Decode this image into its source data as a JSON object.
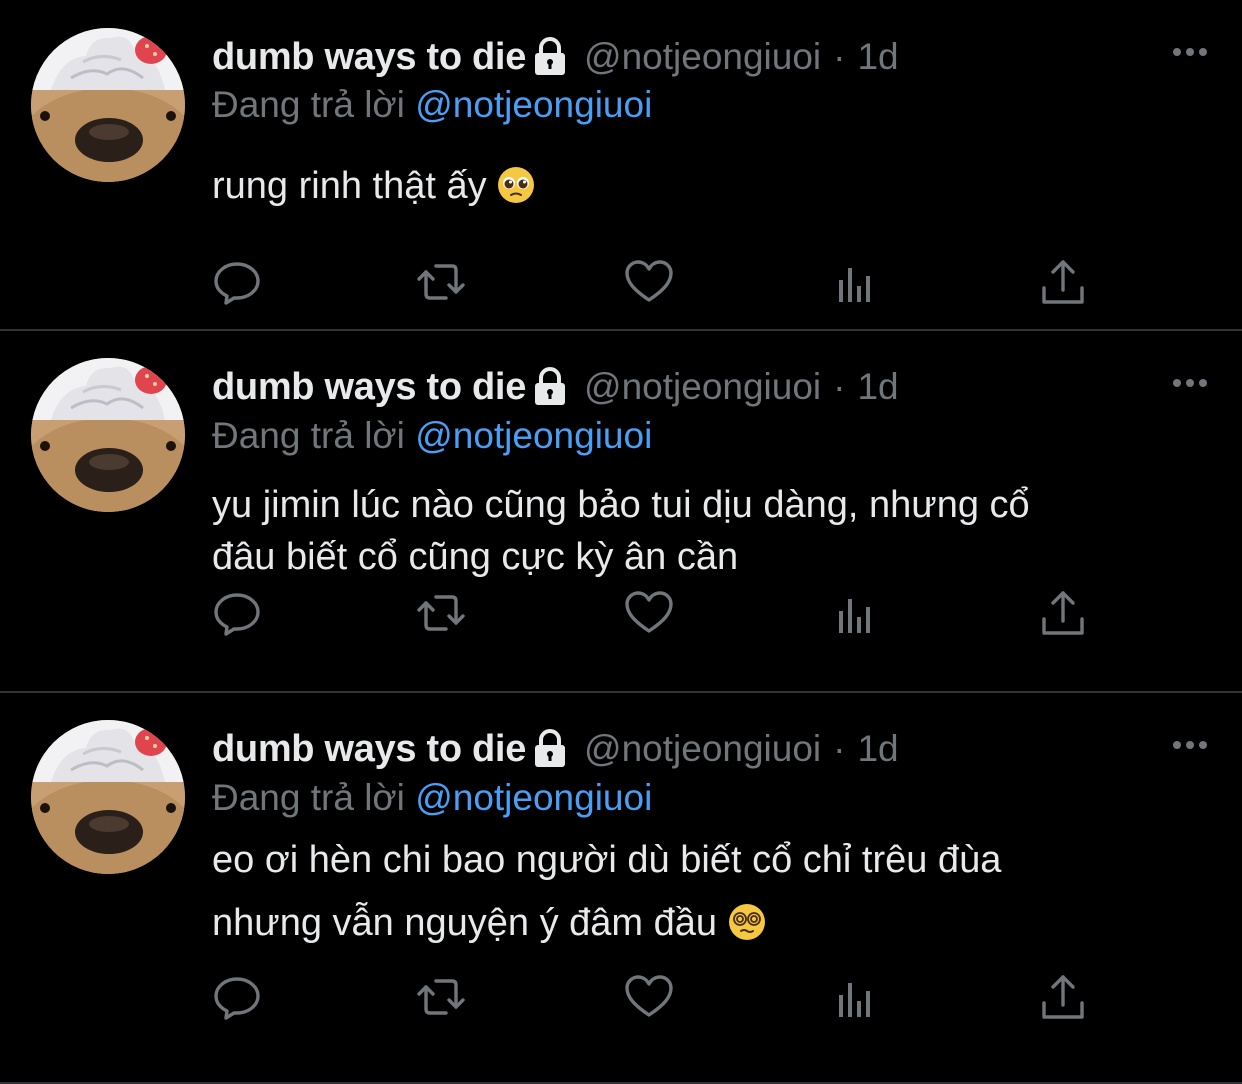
{
  "colors": {
    "background": "#000000",
    "text_primary": "#e7e9ea",
    "text_secondary": "#71767b",
    "mention": "#4a9ff5",
    "divider": "#2f3336"
  },
  "icons": {
    "lock": "lock-icon",
    "more": "more-horizontal-icon",
    "reply": "speech-bubble-icon",
    "retweet": "retweet-arrows-icon",
    "like": "heart-icon",
    "views": "bar-chart-icon",
    "share": "share-upload-icon"
  },
  "tweets": [
    {
      "display_name": "dumb ways to die",
      "handle": "@notjeongiuoi",
      "separator": "·",
      "time": "1d",
      "reply_prefix": "Đang trả lời",
      "reply_to": "@notjeongiuoi",
      "text_lines": [
        "rung rinh thật ấy"
      ],
      "emoji": "pleading-face-emoji"
    },
    {
      "display_name": "dumb ways to die",
      "handle": "@notjeongiuoi",
      "separator": "·",
      "time": "1d",
      "reply_prefix": "Đang trả lời",
      "reply_to": "@notjeongiuoi",
      "text_lines": [
        "yu jimin lúc nào cũng bảo tui dịu dàng, nhưng cổ",
        "đâu biết cổ cũng cực kỳ ân cần"
      ]
    },
    {
      "display_name": "dumb ways to die",
      "handle": "@notjeongiuoi",
      "separator": "·",
      "time": "1d",
      "reply_prefix": "Đang trả lời",
      "reply_to": "@notjeongiuoi",
      "text_lines": [
        "eo ơi hèn chi bao người dù biết cổ chỉ trêu đùa",
        "nhưng vẫn nguyện ý đâm đầu"
      ],
      "emoji": "dizzy-face-emoji"
    }
  ]
}
